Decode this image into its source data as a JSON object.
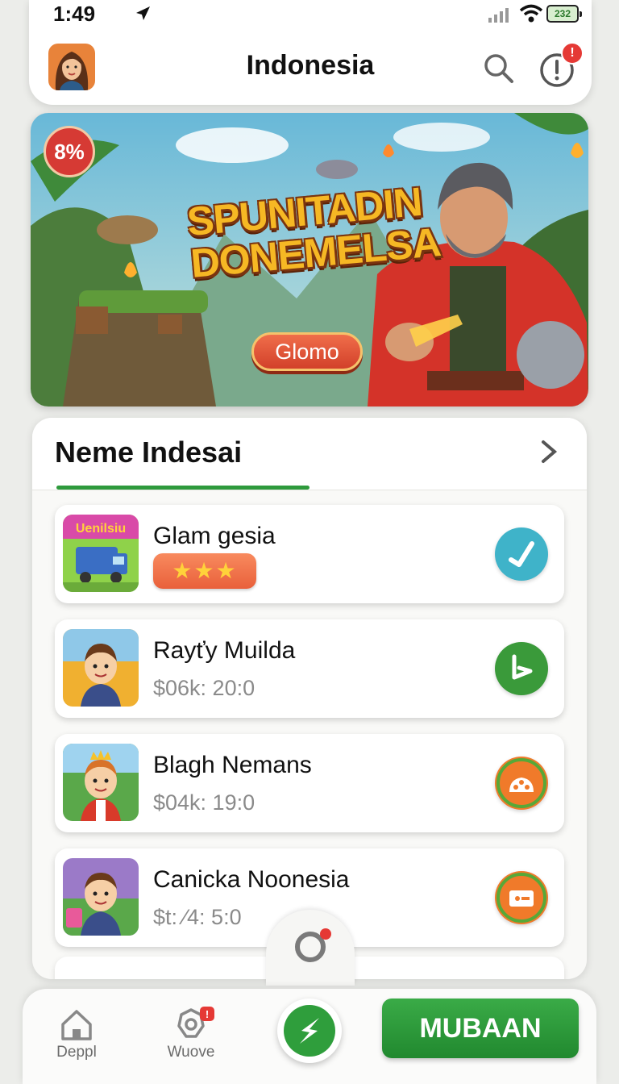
{
  "status_bar": {
    "time": "1:49",
    "battery": "232"
  },
  "header": {
    "title": "Indonesia",
    "notification_badge": "!"
  },
  "banner": {
    "discount": "8%",
    "title_line1": "SPUNITADIN",
    "title_line2": "DONEMELSA",
    "button_label": "Glomo"
  },
  "section": {
    "title": "Neme Indesai",
    "items": [
      {
        "name": "Glam gesia",
        "thumb_label": "Uenilsiu",
        "rating_stars": "★★★",
        "action_icon": "check-icon",
        "action_color": "#3fb3c9"
      },
      {
        "name": "Rayťy Muilda",
        "sub": "$06k: 20:0",
        "action_icon": "play-arrow-icon",
        "action_color": "#3a9a3a"
      },
      {
        "name": "Blagh Nemans",
        "sub": "$04k: 19:0",
        "action_icon": "people-icon",
        "action_color": "#f07a2a"
      },
      {
        "name": "Canicka Noonesia",
        "sub": "$t: ⁄4: 5:0",
        "action_icon": "ticket-icon",
        "action_color": "#f07a2a"
      }
    ]
  },
  "bottom_nav": {
    "items": [
      {
        "label": "Deppl",
        "icon": "home-icon"
      },
      {
        "label": "Wuove",
        "icon": "gear-icon"
      }
    ],
    "fab_icon": "bolt-icon",
    "cta_label": "MUBAAN"
  },
  "colors": {
    "accent_green": "#2e9a3c",
    "badge_red": "#e53935"
  }
}
